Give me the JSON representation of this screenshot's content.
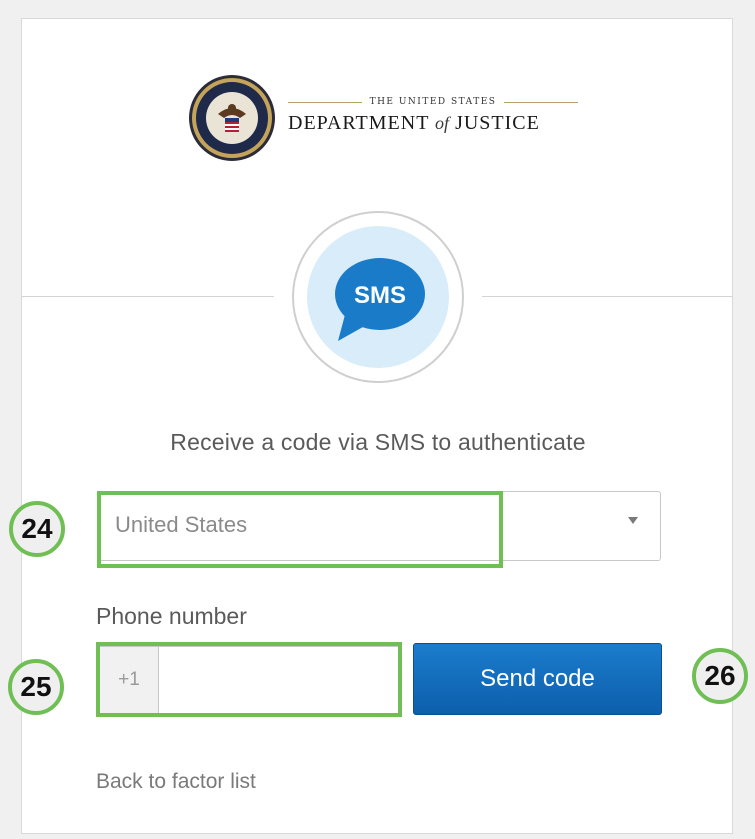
{
  "header": {
    "logo_line1": "THE UNITED STATES",
    "logo_line2_a": "DEPARTMENT",
    "logo_line2_of": "of",
    "logo_line2_b": "JUSTICE",
    "seal_icon": "doj-seal-icon"
  },
  "factor": {
    "badge_text": "SMS",
    "badge_icon": "sms-bubble-icon",
    "title": "Receive a code via SMS to authenticate",
    "accent_color": "#1a7cc9"
  },
  "form": {
    "country_value": "United States",
    "phone_label": "Phone number",
    "phone_prefix": "+1",
    "phone_value": "",
    "send_button": "Send code",
    "back_link": "Back to factor list"
  },
  "annotations": {
    "highlight_color": "#6fbf55",
    "labels": [
      "24",
      "25",
      "26"
    ]
  }
}
